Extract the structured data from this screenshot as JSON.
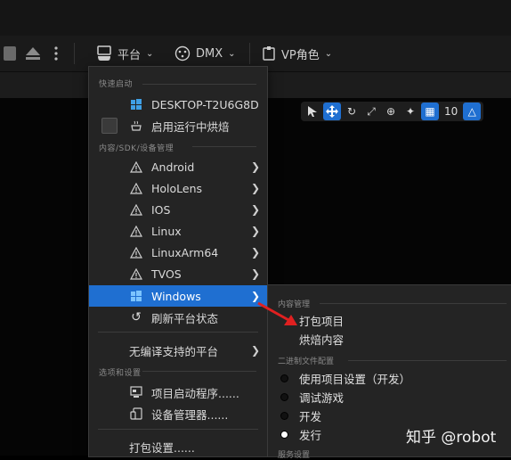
{
  "toolbar": {
    "platform_label": "平台",
    "dmx_label": "DMX",
    "vp_label": "VP角色"
  },
  "viewport_tools": {
    "grid_value": "10"
  },
  "platform_menu": {
    "section_quick_launch": "快速启动",
    "desktop_device": "DESKTOP-T2U6G8D",
    "enable_cook": "启用运行中烘焙",
    "section_content_sdk": "内容/SDK/设备管理",
    "platforms": [
      "Android",
      "HoloLens",
      "IOS",
      "Linux",
      "LinuxArm64",
      "TVOS"
    ],
    "windows": "Windows",
    "refresh": "刷新平台状态",
    "no_compile": "无编译支持的平台",
    "section_options": "选项和设置",
    "launcher": "项目启动程序......",
    "device_manager": "设备管理器......",
    "packaging_settings": "打包设置......"
  },
  "windows_submenu": {
    "section_content": "内容管理",
    "package_project": "打包项目",
    "cook_content": "烘焙内容",
    "section_binary": "二进制文件配置",
    "config_options": [
      {
        "label": "使用项目设置（开发）",
        "selected": false
      },
      {
        "label": "调试游戏",
        "selected": false
      },
      {
        "label": "开发",
        "selected": false
      },
      {
        "label": "发行",
        "selected": true
      }
    ],
    "section_partial": "服务设置"
  },
  "watermark": "知乎 @robot",
  "colors": {
    "highlight": "#1f6fd1",
    "annotation_arrow": "#e02020",
    "menu_bg": "#242424"
  }
}
